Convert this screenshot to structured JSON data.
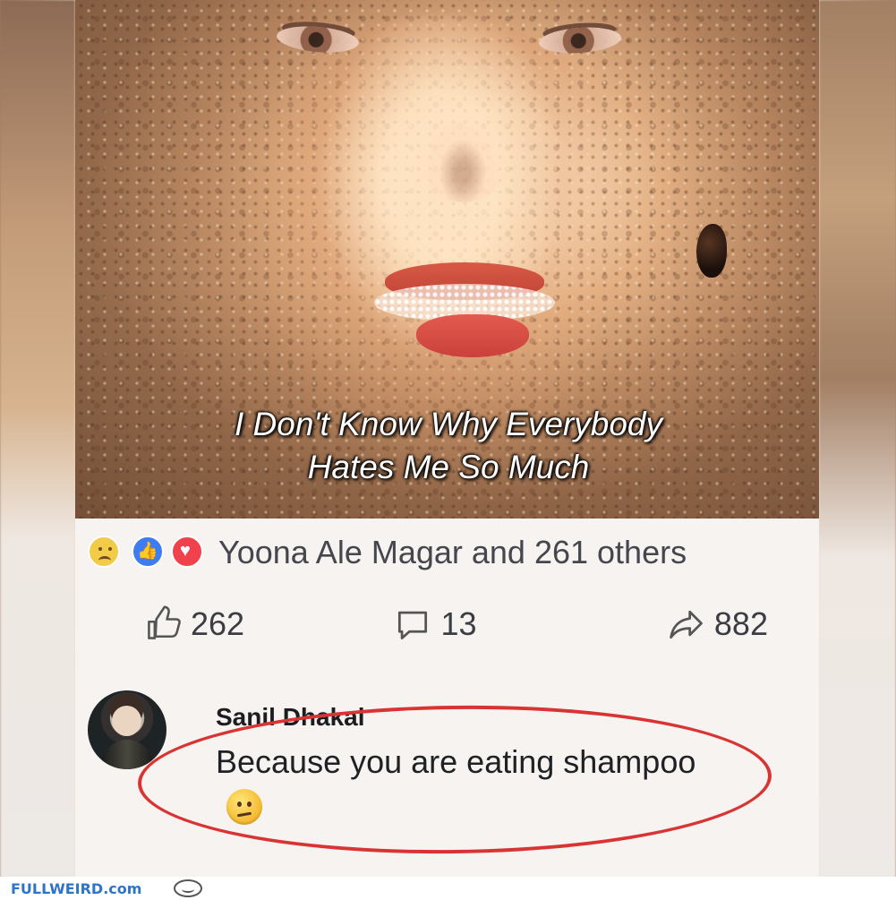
{
  "meme": {
    "caption_line_1": "I Don't Know Why Everybody",
    "caption_line_2": "Hates Me So Much"
  },
  "reactions": {
    "summary": "Yoona Ale Magar and 261 others",
    "icons": [
      "sad-reaction",
      "like-reaction",
      "love-reaction"
    ]
  },
  "stats": {
    "likes": "262",
    "comments": "13",
    "shares": "882"
  },
  "comment": {
    "author": "Sanil Dhakal",
    "text": "Because you are eating shampoo",
    "emoji": "confused-face"
  },
  "footer": {
    "site": "FULLWEIRD.com"
  },
  "colors": {
    "highlight_oval": "#d93434",
    "like_blue": "#3d7cf2",
    "love_red": "#f0414d",
    "footer_blue": "#2e75c7"
  }
}
